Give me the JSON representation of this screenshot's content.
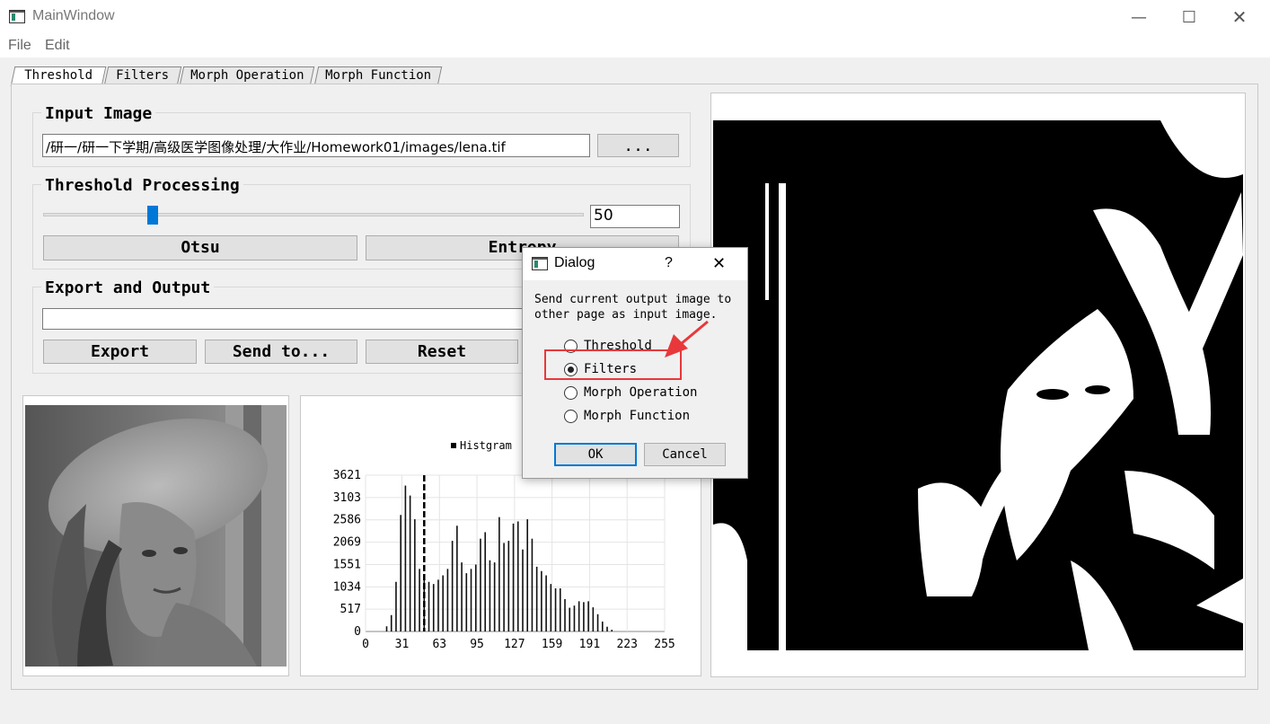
{
  "window": {
    "title": "MainWindow"
  },
  "menu": [
    "File",
    "Edit"
  ],
  "tabs": [
    "Threshold",
    "Filters",
    "Morph Operation",
    "Morph Function"
  ],
  "input_image": {
    "group_title": "Input Image",
    "path": "/研一/研一下学期/高级医学图像处理/大作业/Homework01/images/lena.tif",
    "browse_label": "..."
  },
  "threshold": {
    "group_title": "Threshold Processing",
    "value": "50",
    "slider_fraction": 0.196,
    "otsu_label": "Otsu",
    "entropy_label": "Entropy"
  },
  "export": {
    "group_title": "Export and Output",
    "path": "",
    "export_label": "Export",
    "send_label": "Send to...",
    "reset_label": "Reset"
  },
  "dialog": {
    "title": "Dialog",
    "help": "?",
    "message_line1": "Send current output image to",
    "message_line2": "other page as input image.",
    "options": [
      "Threshold",
      "Filters",
      "Morph Operation",
      "Morph Function"
    ],
    "selected": "Filters",
    "ok_label": "OK",
    "cancel_label": "Cancel"
  },
  "chart_data": {
    "type": "bar",
    "legend": "Histgram",
    "threshold_marker": 50,
    "xlim": [
      0,
      255
    ],
    "ylim": [
      0,
      3621
    ],
    "x_ticks": [
      "0",
      "31",
      "63",
      "95",
      "127",
      "159",
      "191",
      "223",
      "255"
    ],
    "y_ticks": [
      "0",
      "517",
      "1034",
      "1551",
      "2069",
      "2586",
      "3103",
      "3621"
    ],
    "x": [
      18,
      22,
      26,
      30,
      34,
      38,
      42,
      46,
      50,
      54,
      58,
      62,
      66,
      70,
      74,
      78,
      82,
      86,
      90,
      94,
      98,
      102,
      106,
      110,
      114,
      118,
      122,
      126,
      130,
      134,
      138,
      142,
      146,
      150,
      154,
      158,
      162,
      166,
      170,
      174,
      178,
      182,
      186,
      190,
      194,
      198,
      202,
      206,
      210
    ],
    "values": [
      120,
      380,
      1150,
      2700,
      3380,
      3150,
      2600,
      1450,
      1250,
      1150,
      1100,
      1200,
      1300,
      1450,
      2100,
      2450,
      1600,
      1350,
      1450,
      1550,
      2150,
      2300,
      1650,
      1600,
      2650,
      2050,
      2100,
      2500,
      2550,
      1900,
      2600,
      2150,
      1500,
      1400,
      1300,
      1100,
      1000,
      1000,
      750,
      550,
      600,
      700,
      680,
      700,
      560,
      400,
      230,
      110,
      40
    ]
  },
  "colors": {
    "accent": "#0078d7",
    "annotation": "#e8383b"
  }
}
